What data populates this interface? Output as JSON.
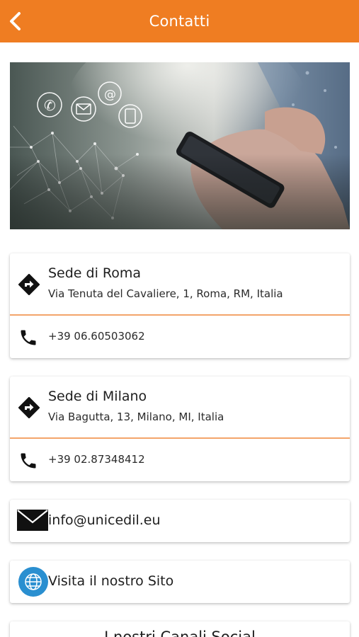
{
  "header": {
    "title": "Contatti",
    "back_icon": "chevron-left-icon",
    "background_color": "#ef7d22"
  },
  "hero": {
    "description_icons": [
      "phone-icon",
      "mail-icon",
      "at-icon",
      "calculator-icon"
    ]
  },
  "offices": [
    {
      "title": "Sede di Roma",
      "address": "Via Tenuta del Cavaliere, 1, Roma, RM, Italia",
      "phone": "+39 06.60503062",
      "directions_icon": "directions-icon",
      "phone_icon": "phone-icon"
    },
    {
      "title": "Sede di Milano",
      "address": "Via Bagutta, 13, Milano, MI, Italia",
      "phone": "+39 02.87348412",
      "directions_icon": "directions-icon",
      "phone_icon": "phone-icon"
    }
  ],
  "email": {
    "label": "info@unicedil.eu",
    "icon": "envelope-icon"
  },
  "website": {
    "label": "Visita il nostro Sito",
    "icon": "globe-icon",
    "icon_color": "#2a8fd0"
  },
  "social": {
    "label": "I nostri Canali Social"
  },
  "colors": {
    "accent": "#ef7d22",
    "separator": "#f3a46a"
  }
}
